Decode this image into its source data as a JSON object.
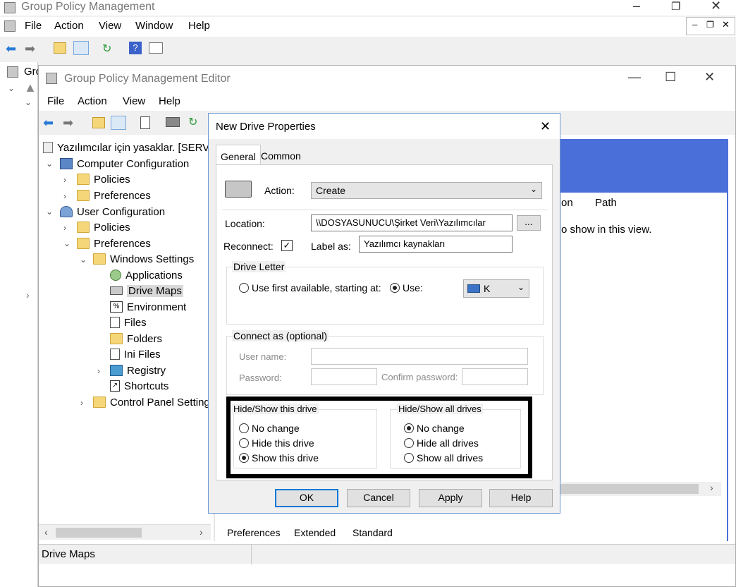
{
  "outer": {
    "title": "Group Policy Management",
    "menu": [
      "File",
      "Action",
      "View",
      "Window",
      "Help"
    ],
    "tree_partial": "Gro"
  },
  "editor": {
    "title": "Group Policy Management Editor",
    "menu": [
      "File",
      "Action",
      "View",
      "Help"
    ],
    "tree": {
      "root": "Yazılımcılar için yasaklar. [SERVE",
      "computer_config": "Computer Configuration",
      "cc_policies": "Policies",
      "cc_preferences": "Preferences",
      "user_config": "User Configuration",
      "uc_policies": "Policies",
      "uc_preferences": "Preferences",
      "windows_settings": "Windows Settings",
      "applications": "Applications",
      "drive_maps": "Drive Maps",
      "environment": "Environment",
      "files": "Files",
      "folders": "Folders",
      "ini_files": "Ini Files",
      "registry": "Registry",
      "shortcuts": "Shortcuts",
      "control_panel": "Control Panel Setting"
    },
    "right_pane": {
      "col_partial": "on",
      "col_path": "Path",
      "empty_text": "o show in this view."
    },
    "bottom_tabs": [
      "Preferences",
      "Extended",
      "Standard"
    ],
    "status": "Drive Maps"
  },
  "dialog": {
    "title": "New Drive Properties",
    "tabs": [
      "General",
      "Common"
    ],
    "action_label": "Action:",
    "action_value": "Create",
    "location_label": "Location:",
    "location_value": "\\\\DOSYASUNUCU\\Şirket Veri\\Yazılımcılar",
    "browse_label": "...",
    "reconnect_label": "Reconnect:",
    "reconnect_checked": true,
    "label_as_label": "Label as:",
    "label_as_value": "Yazılımcı kaynakları",
    "drive_letter": {
      "group": "Drive Letter",
      "use_first": "Use first available, starting at:",
      "use": "Use:",
      "selected": "use",
      "letter": "K"
    },
    "connect_as": {
      "group": "Connect as (optional)",
      "user_name": "User name:",
      "password": "Password:",
      "confirm_password": "Confirm password:"
    },
    "hide_show_this": {
      "group": "Hide/Show this drive",
      "options": [
        "No change",
        "Hide this drive",
        "Show this drive"
      ],
      "selected": 2
    },
    "hide_show_all": {
      "group": "Hide/Show all drives",
      "options": [
        "No change",
        "Hide all drives",
        "Show all drives"
      ],
      "selected": 0
    },
    "buttons": {
      "ok": "OK",
      "cancel": "Cancel",
      "apply": "Apply",
      "help": "Help"
    }
  },
  "colors": {
    "accent": "#0078d7",
    "right_band": "#4a6fd8"
  }
}
